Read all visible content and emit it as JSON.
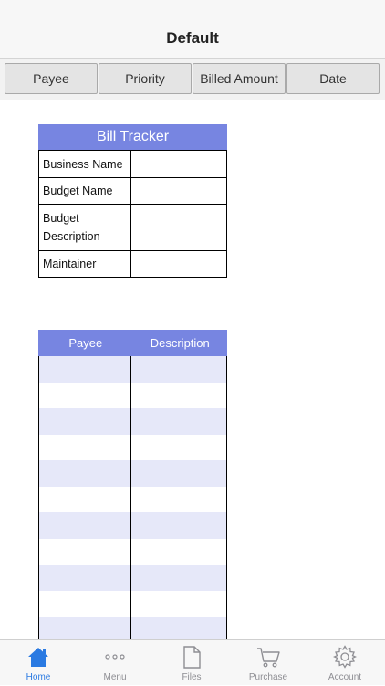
{
  "navbar": {
    "title": "Default"
  },
  "sort_buttons": [
    "Payee",
    "Priority",
    "Billed Amount",
    "Date"
  ],
  "tracker": {
    "title": "Bill Tracker",
    "rows": [
      {
        "label": "Business Name",
        "value": ""
      },
      {
        "label": "Budget Name",
        "value": ""
      },
      {
        "label": "Budget Description",
        "value": ""
      },
      {
        "label": "Maintainer",
        "value": ""
      }
    ]
  },
  "bill_list": {
    "columns": [
      "Payee",
      "Description"
    ],
    "rows": [
      [
        "",
        ""
      ],
      [
        "",
        ""
      ],
      [
        "",
        ""
      ],
      [
        "",
        ""
      ],
      [
        "",
        ""
      ],
      [
        "",
        ""
      ],
      [
        "",
        ""
      ],
      [
        "",
        ""
      ],
      [
        "",
        ""
      ],
      [
        "",
        ""
      ],
      [
        "",
        ""
      ]
    ]
  },
  "tabs": [
    {
      "label": "Home",
      "icon": "home-icon",
      "active": true
    },
    {
      "label": "Menu",
      "icon": "more-dots-icon",
      "active": false
    },
    {
      "label": "Files",
      "icon": "file-icon",
      "active": false
    },
    {
      "label": "Purchase",
      "icon": "cart-icon",
      "active": false
    },
    {
      "label": "Account",
      "icon": "gear-icon",
      "active": false
    }
  ],
  "colors": {
    "accent": "#7785e1",
    "row_alt": "#e6e8f9",
    "tab_active": "#2a7ae2"
  }
}
